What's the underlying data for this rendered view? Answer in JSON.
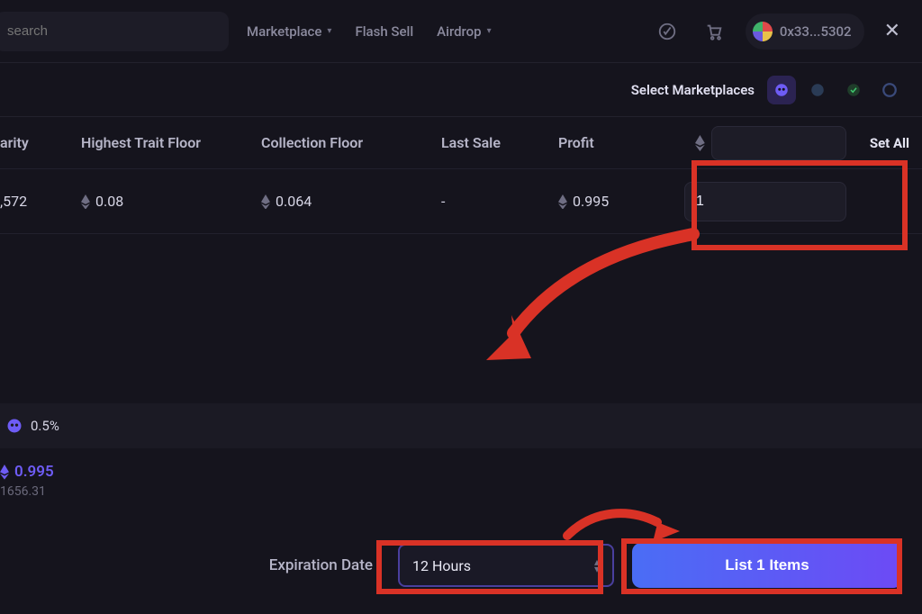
{
  "topbar": {
    "search_placeholder": "search",
    "marketplace_label": "Marketplace",
    "flashsell_label": "Flash Sell",
    "airdrop_label": "Airdrop",
    "wallet_short": "0x33...5302"
  },
  "select_marketplaces_label": "Select Marketplaces",
  "columns": {
    "rarity": "arity",
    "highest_trait_floor": "Highest Trait Floor",
    "collection_floor": "Collection Floor",
    "last_sale": "Last Sale",
    "profit": "Profit",
    "set_all": "Set All"
  },
  "row": {
    "rarity": ",572",
    "htf": "0.08",
    "cfloor": "0.064",
    "last_sale": "-",
    "profit": "0.995",
    "price_value": "1"
  },
  "fee_percent": "0.5%",
  "totals": {
    "eth": "0.995",
    "usd": "1656.31"
  },
  "bottom": {
    "expiration_label": "Expiration Date",
    "expiration_value": "12 Hours",
    "list_button_label": "List 1 Items"
  }
}
